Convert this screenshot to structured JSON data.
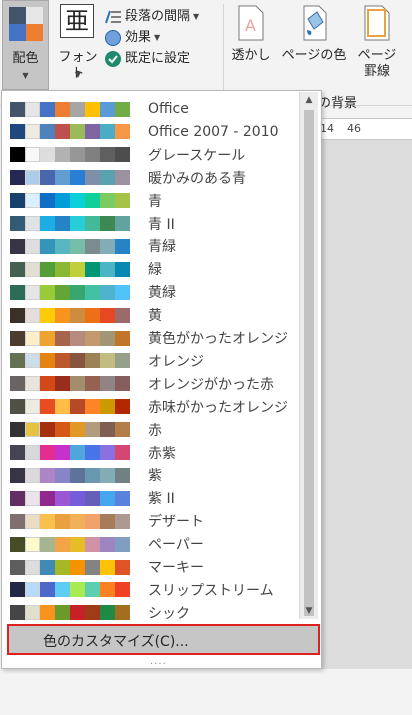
{
  "ribbon": {
    "colors_label": "配色",
    "font_label": "フォント",
    "paragraph_spacing_label": "段落の間隔",
    "effects_label": "効果",
    "set_default_label": "既定に設定",
    "watermark_label": "透かし",
    "page_color_label": "ページの色",
    "page_borders_label_1": "ページ",
    "page_borders_label_2": "罫線",
    "group_label": "の背景"
  },
  "ruler": {
    "tick1": "14",
    "tick2": "46"
  },
  "themes": [
    {
      "name": "Office",
      "colors": [
        "#44546a",
        "#e7e6e6",
        "#4472c4",
        "#ed7d31",
        "#a5a5a5",
        "#ffc000",
        "#5b9bd5",
        "#70ad47"
      ]
    },
    {
      "name": "Office 2007 - 2010",
      "colors": [
        "#1f497d",
        "#eeece1",
        "#4f81bd",
        "#c0504d",
        "#9bbb59",
        "#8064a2",
        "#4bacc6",
        "#f79646"
      ]
    },
    {
      "name": "グレースケール",
      "colors": [
        "#000000",
        "#f8f8f8",
        "#dddddd",
        "#b2b2b2",
        "#969696",
        "#808080",
        "#5f5f5f",
        "#4d4d4d"
      ]
    },
    {
      "name": "暖かみのある青",
      "colors": [
        "#242852",
        "#acccea",
        "#4a66ac",
        "#629dd1",
        "#297fd5",
        "#7f8fa9",
        "#5aa2ae",
        "#9d90a0"
      ]
    },
    {
      "name": "青",
      "colors": [
        "#17406d",
        "#dbefff",
        "#0f6fc6",
        "#009dd9",
        "#0bd0d9",
        "#10cf9b",
        "#7cca62",
        "#a5c249"
      ]
    },
    {
      "name": "青 II",
      "colors": [
        "#335b74",
        "#dfe3e5",
        "#1cade4",
        "#2683c6",
        "#27ced7",
        "#42ba97",
        "#3e8853",
        "#62a39f"
      ]
    },
    {
      "name": "青緑",
      "colors": [
        "#373545",
        "#dedede",
        "#3494ba",
        "#58b6c0",
        "#75bda7",
        "#7a8c8e",
        "#84acb6",
        "#2683c6"
      ]
    },
    {
      "name": "緑",
      "colors": [
        "#455f51",
        "#e3ded1",
        "#549e39",
        "#8ab833",
        "#c0cf3a",
        "#029676",
        "#4ab5c4",
        "#0989b1"
      ]
    },
    {
      "name": "黄緑",
      "colors": [
        "#2c6c58",
        "#e6e6e6",
        "#99cb38",
        "#63a537",
        "#37a76f",
        "#44c1a3",
        "#4eb3cf",
        "#51c3f9"
      ]
    },
    {
      "name": "黄",
      "colors": [
        "#39302a",
        "#e5dedb",
        "#ffca08",
        "#f8931d",
        "#ce8d3e",
        "#ec7016",
        "#e64823",
        "#9c6a6a"
      ]
    },
    {
      "name": "黄色がかったオレンジ",
      "colors": [
        "#4e3b30",
        "#fbeec9",
        "#f0a22e",
        "#a5644e",
        "#b58b80",
        "#c3986d",
        "#a19574",
        "#c17529"
      ]
    },
    {
      "name": "オレンジ",
      "colors": [
        "#637052",
        "#ccddea",
        "#e48312",
        "#bd582c",
        "#865640",
        "#9b8357",
        "#c2bc80",
        "#94a088"
      ]
    },
    {
      "name": "オレンジがかった赤",
      "colors": [
        "#696464",
        "#e9e5dc",
        "#d34817",
        "#9b2d1f",
        "#a28e6a",
        "#956251",
        "#918485",
        "#855d5d"
      ]
    },
    {
      "name": "赤味がかったオレンジ",
      "colors": [
        "#505046",
        "#eeece1",
        "#e84c22",
        "#ffbd47",
        "#b64926",
        "#ff8427",
        "#cc9900",
        "#b22600"
      ]
    },
    {
      "name": "赤",
      "colors": [
        "#323232",
        "#e5c243",
        "#a5300f",
        "#d55816",
        "#e19825",
        "#b19c7d",
        "#7f5f52",
        "#b27d49"
      ]
    },
    {
      "name": "赤紫",
      "colors": [
        "#454551",
        "#d8d9dc",
        "#e32d91",
        "#c830cc",
        "#4ea6dc",
        "#4775e7",
        "#8971e1",
        "#d54773"
      ]
    },
    {
      "name": "紫",
      "colors": [
        "#373545",
        "#dcd8dc",
        "#ad84c6",
        "#8784c7",
        "#5d739a",
        "#6997af",
        "#84acb6",
        "#6f8183"
      ]
    },
    {
      "name": "紫 II",
      "colors": [
        "#632e62",
        "#eae5eb",
        "#92278f",
        "#9b57d3",
        "#755dd9",
        "#665eb8",
        "#45a5ed",
        "#5982db"
      ]
    },
    {
      "name": "デザート",
      "colors": [
        "#7f6f6f",
        "#ebddc3",
        "#fac04e",
        "#e9a03e",
        "#f3b05b",
        "#f0a16c",
        "#a77c5b",
        "#ae9991"
      ]
    },
    {
      "name": "ペーパー",
      "colors": [
        "#444d26",
        "#fefac9",
        "#a5b592",
        "#f3a447",
        "#e7bc29",
        "#d092a7",
        "#9c85c0",
        "#809ec2"
      ]
    },
    {
      "name": "マーキー",
      "colors": [
        "#5e5e5e",
        "#dddddd",
        "#418ab3",
        "#a6b727",
        "#f69200",
        "#838383",
        "#fec306",
        "#df5327"
      ]
    },
    {
      "name": "スリップストリーム",
      "colors": [
        "#212745",
        "#b4dcfa",
        "#4e67c8",
        "#5eccf3",
        "#a7ea52",
        "#5dceaf",
        "#ff8021",
        "#f14124"
      ]
    },
    {
      "name": "シック",
      "colors": [
        "#454545",
        "#e2dfcc",
        "#f8931d",
        "#6a9a2b",
        "#c72127",
        "#9f3b16",
        "#1e8a46",
        "#a26f1f"
      ]
    }
  ],
  "customize_label": "色のカスタマイズ(C)...",
  "grip_text": "....",
  "accent_color": "#e0201b"
}
